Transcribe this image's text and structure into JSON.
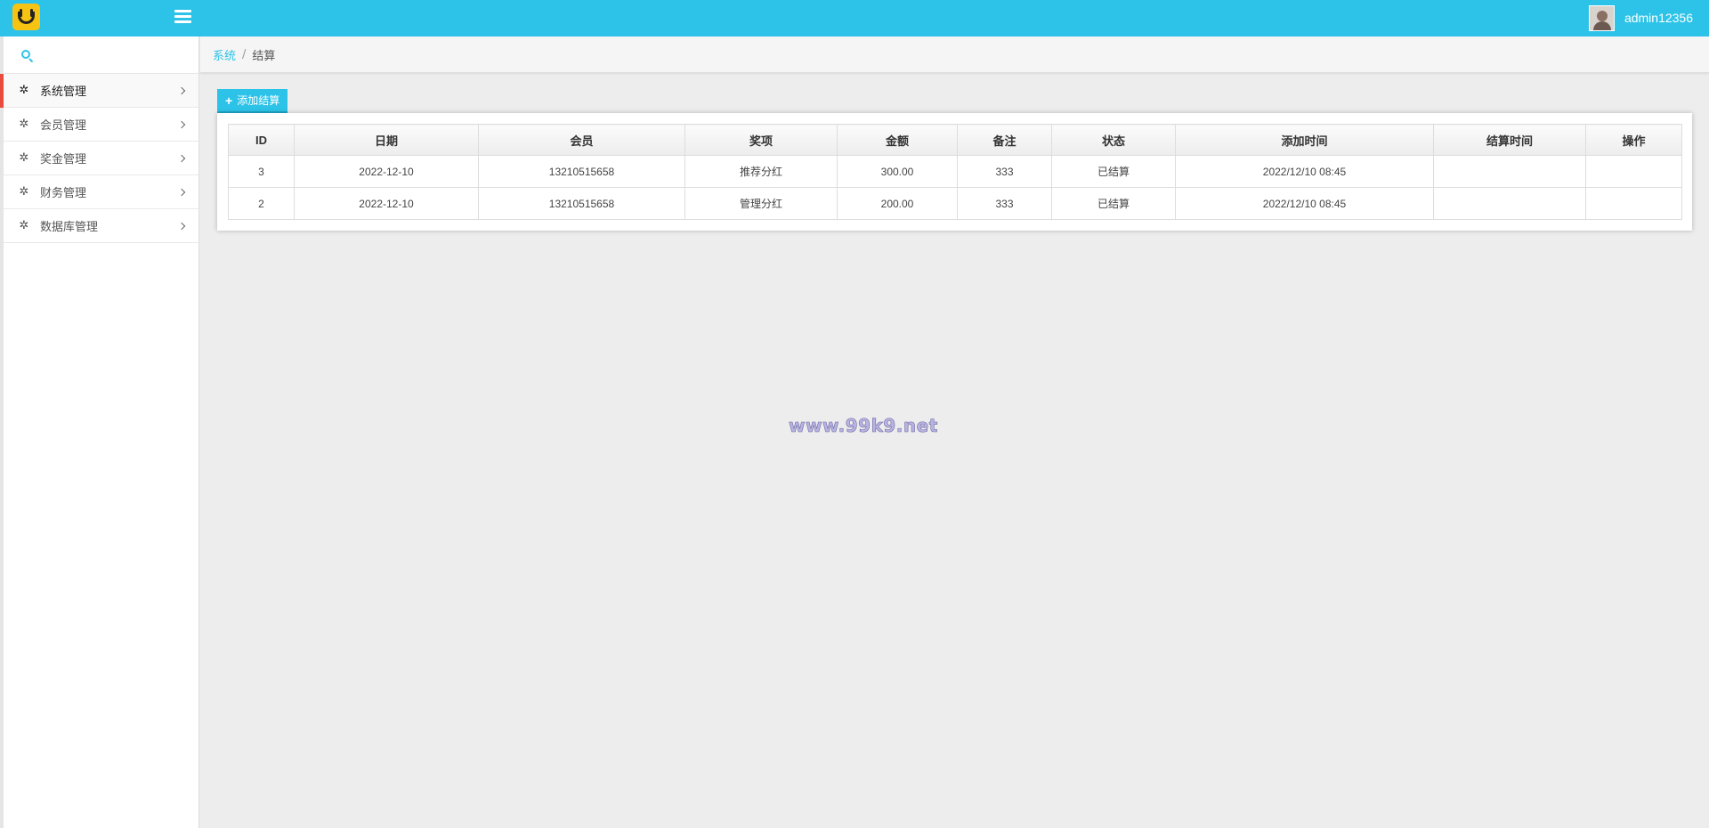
{
  "header": {
    "user_name": "admin12356"
  },
  "sidebar": {
    "search_placeholder": "",
    "items": [
      {
        "label": "系统管理"
      },
      {
        "label": "会员管理"
      },
      {
        "label": "奖金管理"
      },
      {
        "label": "财务管理"
      },
      {
        "label": "数据库管理"
      }
    ]
  },
  "breadcrumb": {
    "root": "系统",
    "separator": "/",
    "current": "结算"
  },
  "toolbar": {
    "add_label": "添加结算"
  },
  "table": {
    "columns": [
      "ID",
      "日期",
      "会员",
      "奖项",
      "金额",
      "备注",
      "状态",
      "添加时间",
      "结算时间",
      "操作"
    ],
    "rows": [
      [
        "3",
        "2022-12-10",
        "13210515658",
        "推荐分红",
        "300.00",
        "333",
        "已结算",
        "2022/12/10 08:45",
        "",
        ""
      ],
      [
        "2",
        "2022-12-10",
        "13210515658",
        "管理分红",
        "200.00",
        "333",
        "已结算",
        "2022/12/10 08:45",
        "",
        ""
      ]
    ]
  },
  "watermark": "www.99k9.net",
  "colors": {
    "accent": "#2dc3e8",
    "active_marker": "#e74c3c",
    "logo": "#f6c312"
  }
}
